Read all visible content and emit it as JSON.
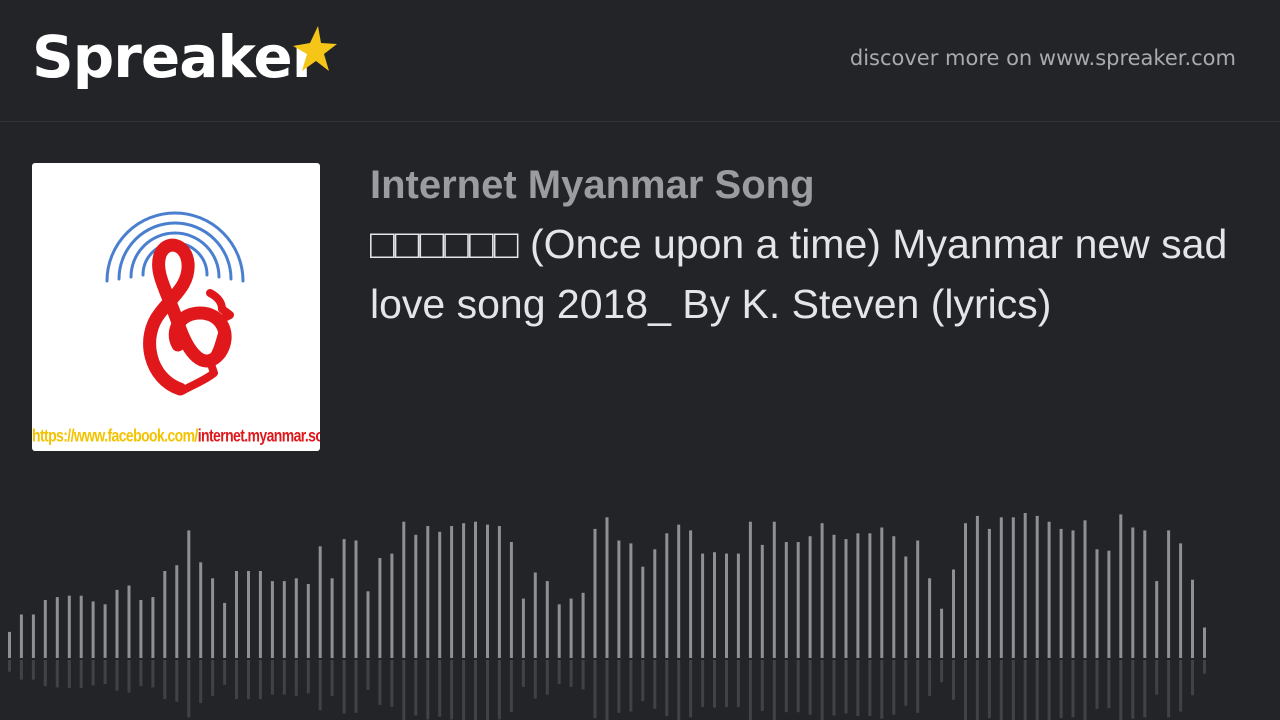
{
  "header": {
    "logo_text": "Spreaker",
    "logo_star_color": "#f5c518",
    "discover_text": "discover more on www.spreaker.com"
  },
  "cover": {
    "icon": "treble-clef-face-broadcast-icon",
    "url_part1": "https://www.facebook.com/",
    "url_part2": "internet.myanmar.song/",
    "colors": {
      "arcs": "#4a7fd0",
      "clef": "#e0181b",
      "url1": "#f3c300",
      "url2": "#e0181b"
    }
  },
  "episode": {
    "show_title": "Internet Myanmar Song",
    "title": "□□□□□□ (Once upon a time) Myanmar new sad love song 2018_ By K. Steven (lyrics)"
  },
  "waveform": {
    "color": "#8f9094",
    "levels": [
      0.18,
      0.3,
      0.3,
      0.4,
      0.42,
      0.43,
      0.43,
      0.39,
      0.37,
      0.47,
      0.5,
      0.4,
      0.42,
      0.6,
      0.64,
      0.88,
      0.66,
      0.55,
      0.38,
      0.6,
      0.6,
      0.6,
      0.53,
      0.53,
      0.55,
      0.51,
      0.77,
      0.55,
      0.82,
      0.81,
      0.46,
      0.69,
      0.72,
      0.94,
      0.85,
      0.91,
      0.87,
      0.91,
      0.93,
      0.94,
      0.92,
      0.91,
      0.8,
      0.41,
      0.59,
      0.53,
      0.37,
      0.41,
      0.45,
      0.89,
      0.97,
      0.81,
      0.79,
      0.63,
      0.75,
      0.86,
      0.92,
      0.88,
      0.72,
      0.73,
      0.72,
      0.72,
      0.94,
      0.78,
      0.94,
      0.8,
      0.8,
      0.84,
      0.93,
      0.85,
      0.82,
      0.86,
      0.86,
      0.9,
      0.84,
      0.7,
      0.81,
      0.55,
      0.34,
      0.61,
      0.93,
      0.98,
      0.89,
      0.97,
      0.97,
      1.0,
      0.98,
      0.94,
      0.89,
      0.88,
      0.95,
      0.75,
      0.74,
      0.99,
      0.9,
      0.88,
      0.53,
      0.88,
      0.79,
      0.54,
      0.21
    ]
  }
}
